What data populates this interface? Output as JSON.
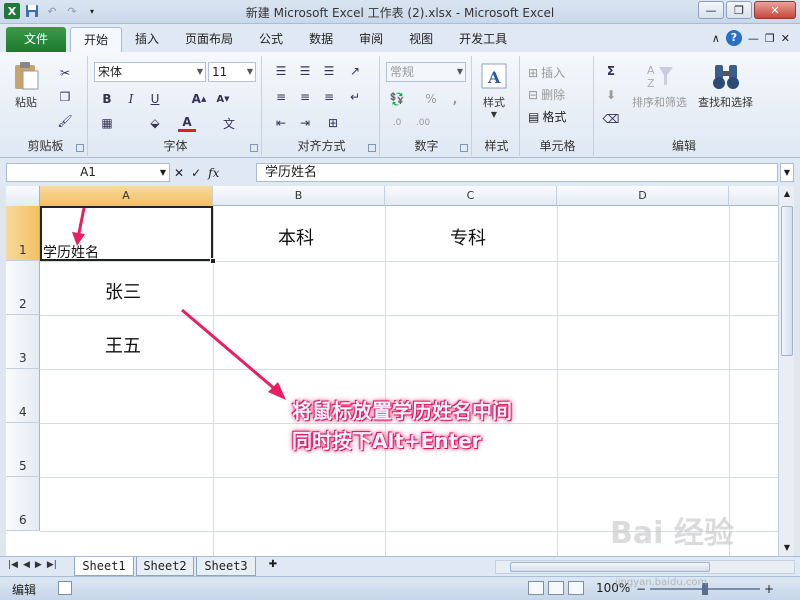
{
  "window": {
    "title": "新建 Microsoft Excel 工作表 (2).xlsx - Microsoft Excel"
  },
  "ribbon": {
    "file_tab": "文件",
    "tabs": [
      "开始",
      "插入",
      "页面布局",
      "公式",
      "数据",
      "审阅",
      "视图",
      "开发工具"
    ],
    "active_tab": "开始",
    "groups": {
      "clipboard": {
        "label": "剪贴板",
        "paste": "粘贴"
      },
      "font": {
        "label": "字体",
        "font_name": "宋体",
        "font_size": "11"
      },
      "alignment": {
        "label": "对齐方式"
      },
      "number": {
        "label": "数字",
        "format": "常规"
      },
      "styles": {
        "label": "样式",
        "styles_btn": "样式"
      },
      "cells": {
        "label": "单元格",
        "insert": "插入",
        "delete": "删除",
        "format": "格式"
      },
      "editing": {
        "label": "编辑",
        "sort": "排序和筛选",
        "find": "查找和选择"
      }
    }
  },
  "formula_bar": {
    "name_box": "A1",
    "fx": "fx",
    "content": "学历姓名"
  },
  "grid": {
    "columns": [
      "A",
      "B",
      "C",
      "D"
    ],
    "rows": [
      "1",
      "2",
      "3",
      "4",
      "5",
      "6"
    ],
    "cells": {
      "A1": "学历姓名",
      "B1": "本科",
      "C1": "专科",
      "A2": "张三",
      "A3": "王五"
    }
  },
  "sheets": [
    "Sheet1",
    "Sheet2",
    "Sheet3"
  ],
  "active_sheet": "Sheet1",
  "status": {
    "mode": "编辑",
    "zoom": "100%"
  },
  "annotation": {
    "line1": "将鼠标放置学历姓名中间",
    "line2": "同时按下Alt+Enter",
    "color": "#e91e63"
  },
  "watermark": {
    "logo": "Bai 经验",
    "url": "jingyan.baidu.com"
  }
}
